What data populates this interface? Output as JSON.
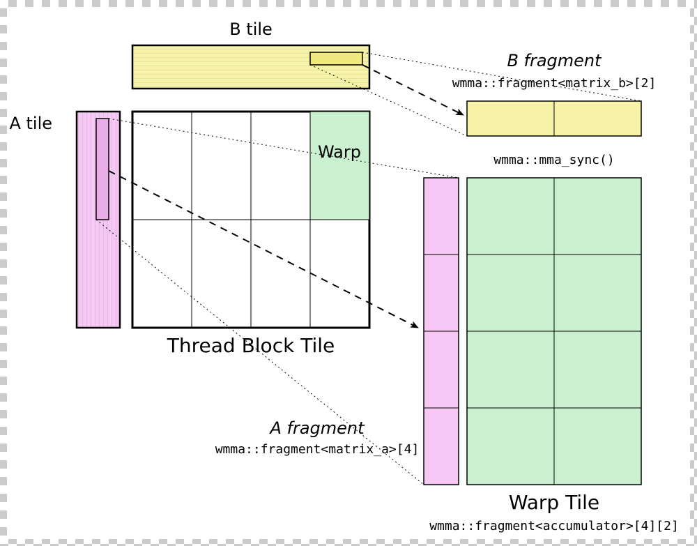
{
  "colors": {
    "a_fill": "#f7c7f6",
    "b_fill": "#f6f3a8",
    "warp_fill": "#caf0d0",
    "stroke": "#000000"
  },
  "labels": {
    "a_tile": "A tile",
    "b_tile": "B tile",
    "thread_block_tile": "Thread Block Tile",
    "warp": "Warp",
    "b_fragment_title": "B fragment",
    "b_fragment_code": "wmma::fragment<matrix_b>[2]",
    "mma_sync": "wmma::mma_sync()",
    "a_fragment_title": "A fragment",
    "a_fragment_code": "wmma::fragment<matrix_a>[4]",
    "warp_tile": "Warp Tile",
    "accumulator_code": "wmma::fragment<accumulator>[4][2]"
  },
  "chart_data": {
    "type": "diagram",
    "description": "CUDA WMMA tile hierarchy: Thread Block Tile decomposed into Warp Tiles, with A and B matrix tiles feeding into A/B fragments for wmma::mma_sync accumulation.",
    "thread_block_tile": {
      "grid_cols": 4,
      "grid_rows": 2
    },
    "warp_tile": {
      "grid_cols": 2,
      "grid_rows": 4
    },
    "a_fragment_count": 4,
    "b_fragment_count": 2,
    "accumulator_shape": [
      4,
      2
    ]
  }
}
